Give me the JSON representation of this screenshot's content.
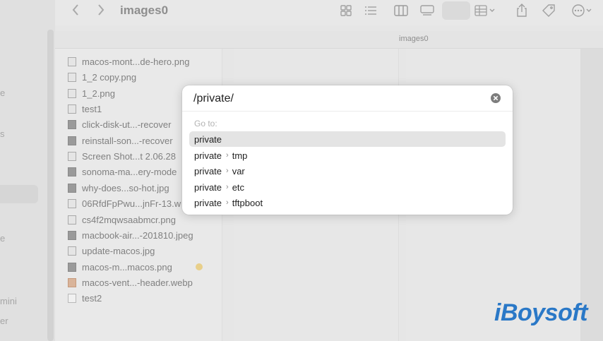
{
  "toolbar": {
    "folder_title": "images0",
    "back_icon": "chevron-left-icon",
    "forward_icon": "chevron-right-icon"
  },
  "pathbar": {
    "label": "images0"
  },
  "sidebar": {
    "fragments": [
      "e",
      "s",
      "e",
      "mini",
      "er"
    ]
  },
  "files": [
    {
      "name": "macos-mont...de-hero.png",
      "kind": "light"
    },
    {
      "name": "1_2 copy.png",
      "kind": "light"
    },
    {
      "name": "1_2.png",
      "kind": "light"
    },
    {
      "name": "test1",
      "kind": "light"
    },
    {
      "name": "click-disk-ut...-recover",
      "kind": "dark"
    },
    {
      "name": "reinstall-son...-recover",
      "kind": "dark"
    },
    {
      "name": "Screen Shot...t 2.06.28",
      "kind": "light"
    },
    {
      "name": "sonoma-ma...ery-mode",
      "kind": "dark"
    },
    {
      "name": "why-does...so-hot.jpg",
      "kind": "dark"
    },
    {
      "name": "06RfdFpPwu...jnFr-13.w",
      "kind": "light"
    },
    {
      "name": "cs4f2mqwsaabmcr.png",
      "kind": "light"
    },
    {
      "name": "macbook-air...-201810.jpeg",
      "kind": "dark"
    },
    {
      "name": "update-macos.jpg",
      "kind": "light"
    },
    {
      "name": "macos-m...macos.png",
      "kind": "dark"
    },
    {
      "name": "macos-vent...-header.webp",
      "kind": "orange"
    },
    {
      "name": "test2",
      "kind": "doc"
    }
  ],
  "dialog": {
    "input_value": "/private/",
    "goto_label": "Go to:",
    "suggestions": [
      {
        "base": "private",
        "sub": ""
      },
      {
        "base": "private",
        "sub": "tmp"
      },
      {
        "base": "private",
        "sub": "var"
      },
      {
        "base": "private",
        "sub": "etc"
      },
      {
        "base": "private",
        "sub": "tftpboot"
      }
    ],
    "chevron": "›"
  },
  "watermark": "iBoysoft",
  "colors": {
    "selection": "#e4e4e4",
    "watermark": "#2a78c7",
    "tag_yellow": "#e8cf8a"
  }
}
